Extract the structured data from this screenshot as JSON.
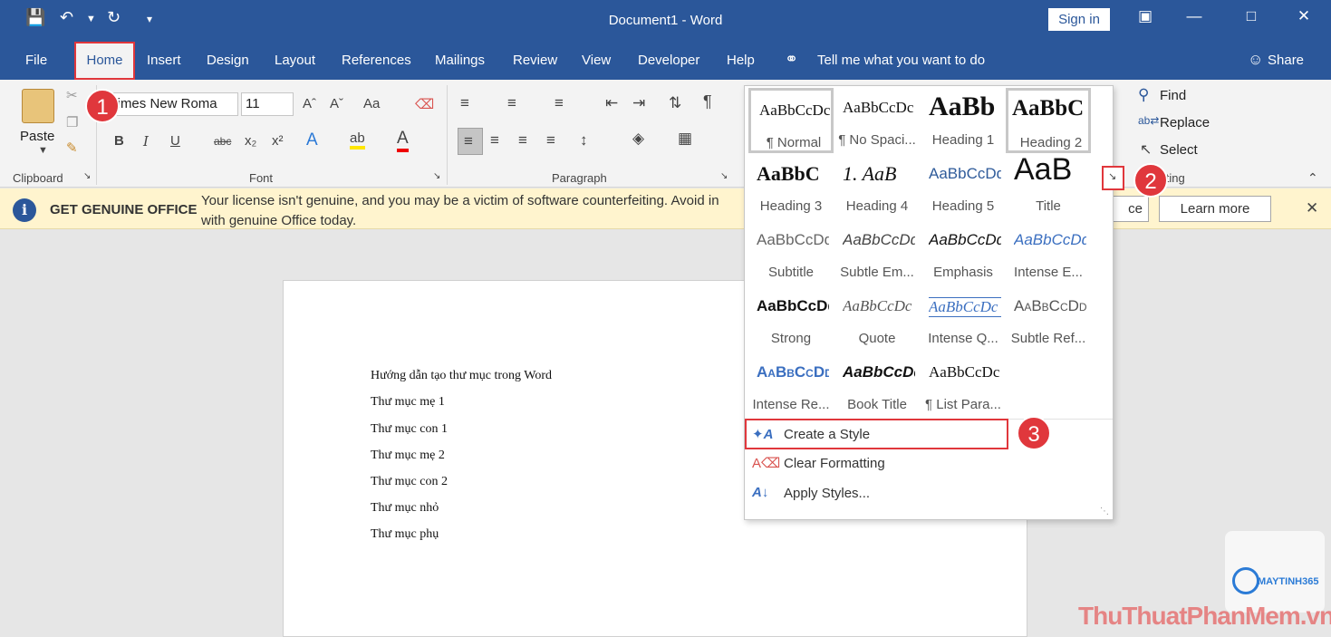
{
  "title_bar": {
    "document_title": "Document1  -  Word",
    "sign_in_label": "Sign in"
  },
  "tabs": [
    "File",
    "Home",
    "Insert",
    "Design",
    "Layout",
    "References",
    "Mailings",
    "Review",
    "View",
    "Developer",
    "Help"
  ],
  "tell_me": "Tell me what you want to do",
  "share_label": "Share",
  "ribbon": {
    "clipboard": {
      "paste_label": "Paste",
      "group_label": "Clipboard"
    },
    "font": {
      "font_name": "Times New Roma",
      "font_size": "11",
      "group_label": "Font"
    },
    "paragraph": {
      "group_label": "Paragraph"
    },
    "editing": {
      "find_label": "Find",
      "replace_label": "Replace",
      "select_label": "Select",
      "group_label": "Editing"
    }
  },
  "message_bar": {
    "title": "GET GENUINE OFFICE",
    "text": "Your license isn't genuine, and you may be a victim of software counterfeiting. Avoid in with genuine Office today.",
    "button_partial": "ce",
    "learn_more": "Learn more"
  },
  "document_lines": [
    "Hướng dẫn tạo thư mục trong Word",
    "Thư mục mẹ 1",
    "Thư mục con 1",
    "Thư mục mẹ 2",
    "Thư mục con 2",
    "Thư mục nhỏ",
    "Thư mục phụ"
  ],
  "styles_gallery": {
    "styles": [
      {
        "sample": "AaBbCcDc",
        "label": "¶ Normal"
      },
      {
        "sample": "AaBbCcDc",
        "label": "¶ No Spaci..."
      },
      {
        "sample": "AaBb",
        "label": "Heading 1"
      },
      {
        "sample": "AaBbC",
        "label": "Heading 2"
      },
      {
        "sample": "AaBbC",
        "label": "Heading 3"
      },
      {
        "sample": "1.  AaB",
        "label": "Heading 4"
      },
      {
        "sample": "AaBbCcDd",
        "label": "Heading 5"
      },
      {
        "sample": "AaB",
        "label": "Title"
      },
      {
        "sample": "AaBbCcDd",
        "label": "Subtitle"
      },
      {
        "sample": "AaBbCcDd",
        "label": "Subtle Em..."
      },
      {
        "sample": "AaBbCcDd",
        "label": "Emphasis"
      },
      {
        "sample": "AaBbCcDd",
        "label": "Intense E..."
      },
      {
        "sample": "AaBbCcDd",
        "label": "Strong"
      },
      {
        "sample": "AaBbCcDc",
        "label": "Quote"
      },
      {
        "sample": "AaBbCcDc",
        "label": "Intense Q..."
      },
      {
        "sample": "AaBbCcDd",
        "label": "Subtle Ref..."
      },
      {
        "sample": "AaBbCcDd",
        "label": "Intense Re..."
      },
      {
        "sample": "AaBbCcDd",
        "label": "Book Title"
      },
      {
        "sample": "AaBbCcDc",
        "label": "¶ List Para..."
      }
    ],
    "menu": [
      "Create a Style",
      "Clear Formatting",
      "Apply Styles..."
    ]
  },
  "callouts": [
    "1",
    "2",
    "3"
  ],
  "watermark": {
    "brand": "MAYTINH365",
    "site": "ThuThuatPhanMem.vn"
  },
  "colors": {
    "accent": "#2b579a",
    "highlight": "#e0373c",
    "message_bg": "#fff4ce"
  }
}
